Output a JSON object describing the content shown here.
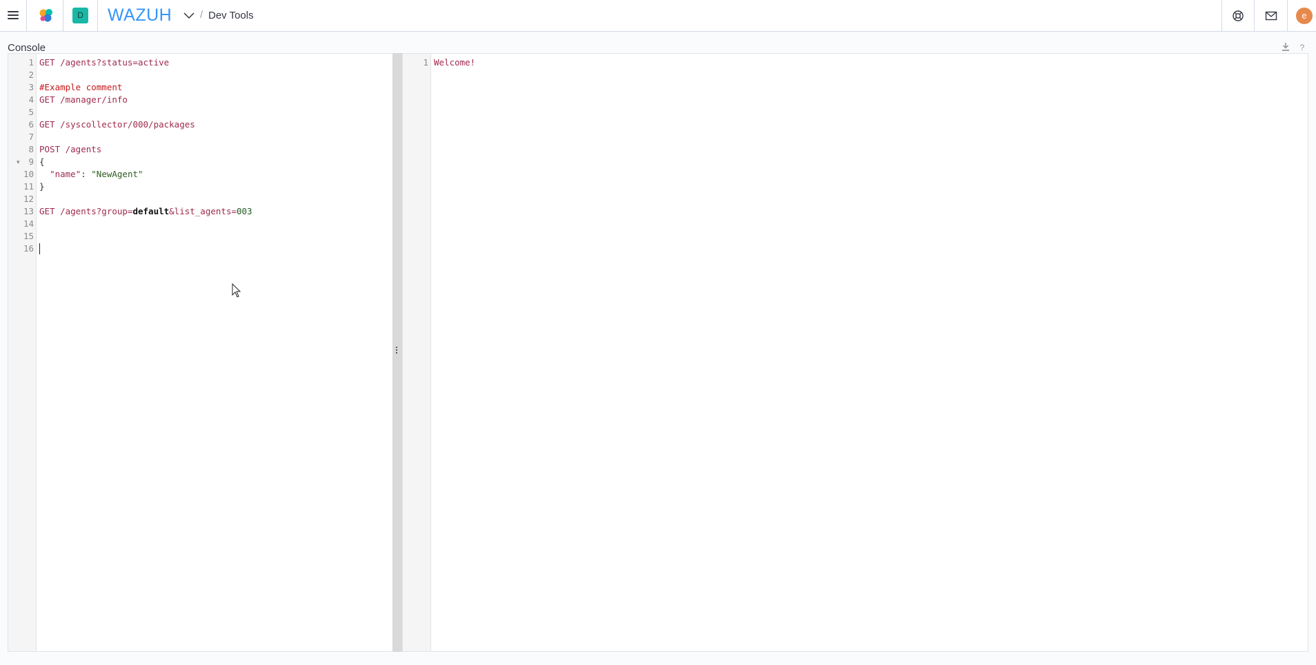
{
  "header": {
    "brand": "WAZUH",
    "space_letter": "D",
    "breadcrumb": "Dev Tools",
    "user_initial": "e",
    "icons": [
      "menu-icon",
      "opensearch-logo",
      "chevron-down-icon",
      "help-lifebuoy-icon",
      "mail-icon"
    ]
  },
  "console": {
    "title": "Console",
    "toolbar_icons": [
      "download-icon",
      "help-question-icon"
    ]
  },
  "request_editor": {
    "line_numbers": [
      "1",
      "2",
      "3",
      "4",
      "5",
      "6",
      "7",
      "8",
      "9",
      "10",
      "11",
      "12",
      "13",
      "14",
      "15",
      "16"
    ],
    "lines": {
      "l1": "GET /agents?status=active",
      "l3": "#Example comment",
      "l4": "GET /manager/info",
      "l6": "GET /syscollector/000/packages",
      "l8": "POST /agents",
      "l9": "{",
      "l10_key": "\"name\"",
      "l10_sep": ": ",
      "l10_val": "\"NewAgent\"",
      "l11": "}",
      "l13_a": "GET /agents?group=",
      "l13_b": "default",
      "l13_c": "&list_agents=",
      "l13_d": "003"
    }
  },
  "response_editor": {
    "line_numbers": [
      "1"
    ],
    "lines": {
      "l1": "Welcome!"
    }
  },
  "colors": {
    "brand": "#3595f9",
    "space_badge": "#19b8a6",
    "avatar": "#e7894d",
    "keyword": "#9f2a4c",
    "comment": "#c51a1a"
  }
}
